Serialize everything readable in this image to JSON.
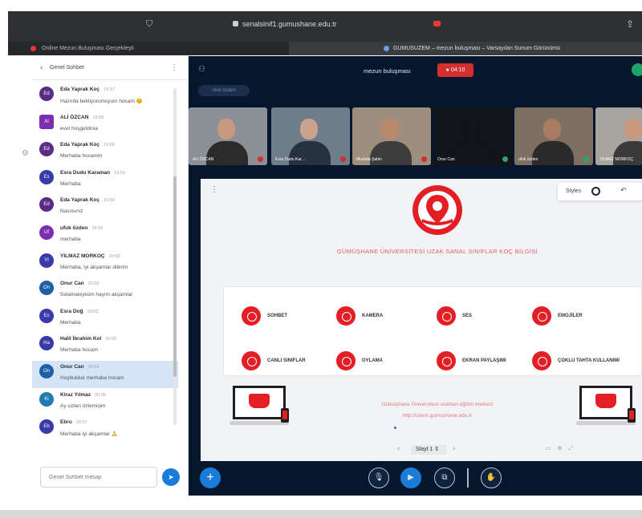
{
  "browser": {
    "url": "senalsinif1.gumushane.edu.tr",
    "tab_left": "Online Mezun Buluşması Gerçekleşti",
    "tab_right": "GUMUSUZEM – mezun buluşması – Varsayılan Sunum Görünümü"
  },
  "chat": {
    "title": "Genel Sohbet",
    "input_placeholder": "Genel Sohbet mesajı",
    "messages": [
      {
        "initials": "Ed",
        "name": "Eda Yaprak Koç",
        "time": "19:57",
        "text": "Hazırda bekliyorumsyum hocam 😊",
        "color": "#5b2c83"
      },
      {
        "initials": "Al",
        "name": "ALİ ÖZCAN",
        "time": "19:58",
        "text": "evet hoşgeldinia",
        "color": "#7b2fb0"
      },
      {
        "initials": "Ed",
        "name": "Eda Yaprak Koç",
        "time": "19:58",
        "text": "Merhaba hocamm",
        "color": "#5b2c83"
      },
      {
        "initials": "Es",
        "name": "Esra Dudu Karaman",
        "time": "19:59",
        "text": "Merhaba",
        "color": "#3a3aa8"
      },
      {
        "initials": "Ed",
        "name": "Eda Yaprak Koç",
        "time": "19:59",
        "text": "Nasılsınız",
        "color": "#5b2c83"
      },
      {
        "initials": "Uf",
        "name": "ufuk özden",
        "time": "19:59",
        "text": "merhaba",
        "color": "#7b2fb0"
      },
      {
        "initials": "YI",
        "name": "YILMAZ MORKOÇ",
        "time": "20:00",
        "text": "Merhaba, iyi akşamlar dilerim",
        "color": "#3a3aa8"
      },
      {
        "initials": "On",
        "name": "Onur Can",
        "time": "20:00",
        "text": "Selamaleyküm hayırlı akşamlar",
        "color": "#1f5fa8"
      },
      {
        "initials": "Es",
        "name": "Esra Doğ",
        "time": "20:03",
        "text": "Merhaba",
        "color": "#3a3aa8"
      },
      {
        "initials": "Ha",
        "name": "Halil İbrahim Kol",
        "time": "20:03",
        "text": "Merhaba hocam",
        "color": "#3a3aa8"
      },
      {
        "initials": "On",
        "name": "Onur Can",
        "time": "20:04",
        "text": "Hoşbulduk merhaba hocam",
        "color": "#1f5fa8"
      },
      {
        "initials": "Ki",
        "name": "Kiraz Yılmaz",
        "time": "20:05",
        "text": "Ay sizleri özlemişim",
        "color": "#1f7bb0"
      },
      {
        "initials": "Eb",
        "name": "Ebru",
        "time": "20:07",
        "text": "Merhaba iyi akşamlar 🙏",
        "color": "#3a3aa8"
      }
    ]
  },
  "meeting": {
    "title": "mezun buluşması",
    "rec_time": "04:10",
    "speaker_pill": "ufuk özden"
  },
  "cams": [
    {
      "name": "ALİ ÖZCAN",
      "mic_on": false,
      "bg": "#8b8f96",
      "skin": "#c8997f",
      "shirt": "#2b2b2b"
    },
    {
      "name": "Esra Dudu Kar…",
      "mic_on": false,
      "bg": "#6f7c8a",
      "skin": "#c9a38d",
      "shirt": "#26323f"
    },
    {
      "name": "Mustafa Şahin",
      "mic_on": false,
      "bg": "#9c8f7d",
      "skin": "#b88a6b",
      "shirt": "#3d3d3d"
    },
    {
      "name": "Onur Can",
      "mic_on": true,
      "bg": "#111418",
      "skin": "#111418",
      "shirt": "#111418"
    },
    {
      "name": "ufuk özden",
      "mic_on": true,
      "bg": "#7d6f62",
      "skin": "#a97c62",
      "shirt": "#2a2a2a"
    },
    {
      "name": "YILMAZ MORKOÇ",
      "mic_on": false,
      "bg": "#a7a59e",
      "skin": "#c8997f",
      "shirt": "#3a3a3a"
    }
  ],
  "slide": {
    "styles_label": "Styles",
    "title": "GÜMÜŞHANE ÜNİVERSİTESİ UZAK SANAL SINIFLAR KOÇ BİLGİSİ",
    "features": [
      "SOHBET",
      "KAMERA",
      "SES",
      "EMOJİLER",
      "CANLI SINIFLAR",
      "OYLAMA",
      "EKRAN PAYLAŞIMI",
      "ÇOKLU TAHTA KULLANIMI"
    ],
    "footer_text": "Gümüşhane Üniversitesi uzaktan eğitim merkezi",
    "footer_url": "http://uzem.gumushane.edu.tr",
    "slide_label": "Slayt 1"
  },
  "colors": {
    "accent": "#1b7bd8",
    "brand_red": "#e41e25",
    "bg_dark": "#06172d"
  }
}
